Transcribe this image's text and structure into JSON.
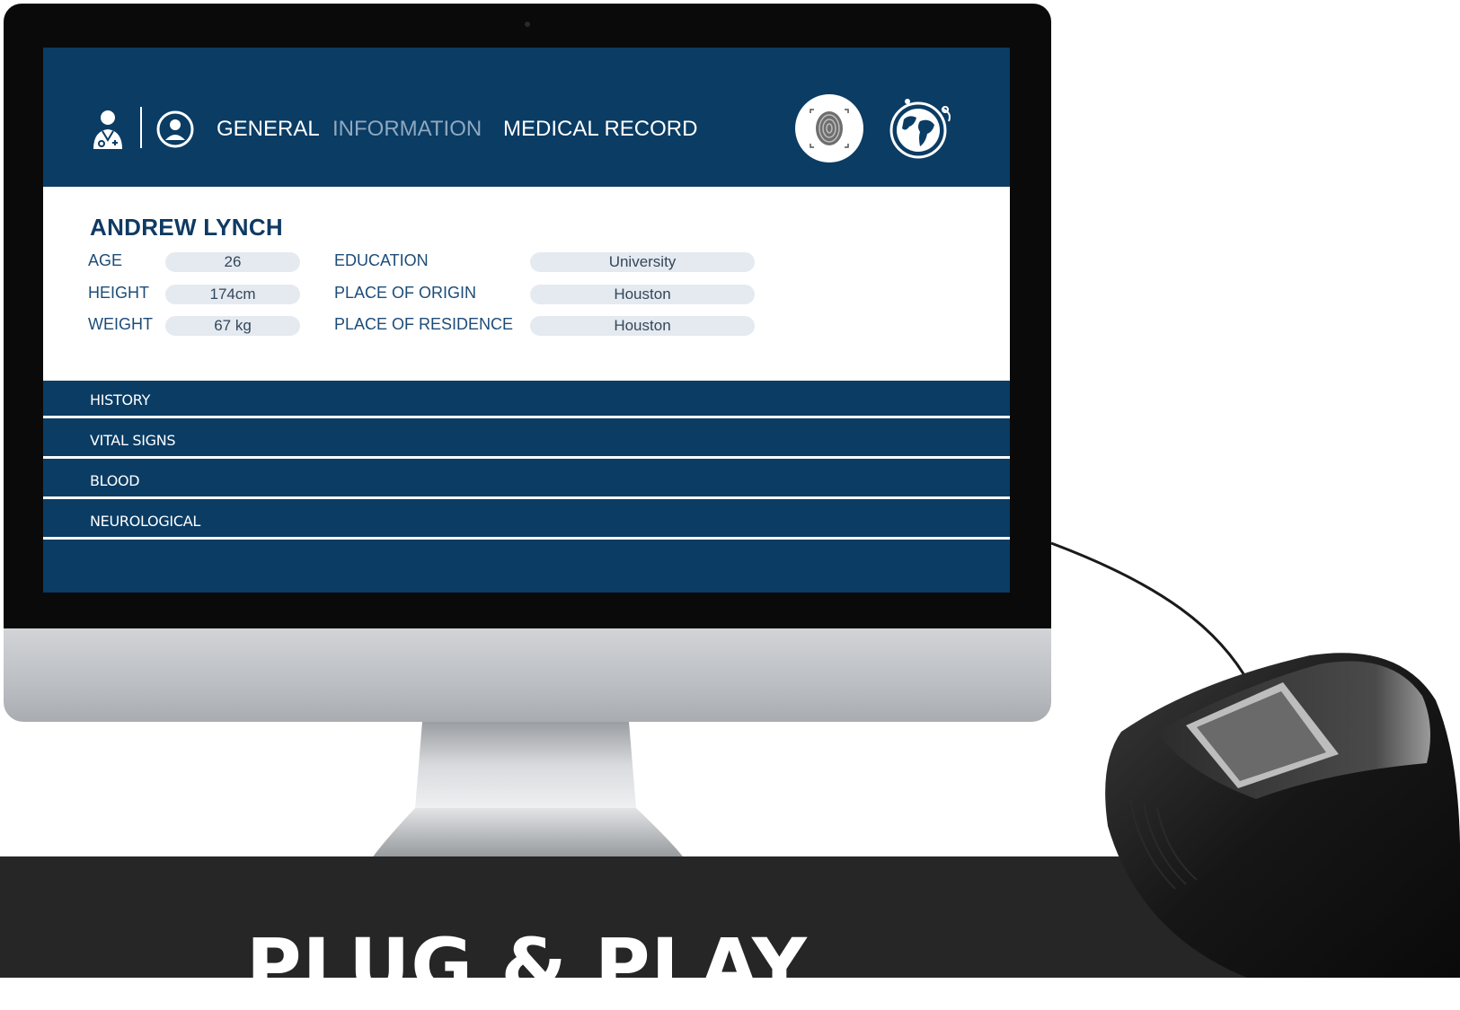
{
  "screen": {
    "nav": {
      "tabs": [
        {
          "label": "GENERAL"
        },
        {
          "label": "INFORMATION"
        },
        {
          "label": "MEDICAL RECORD"
        }
      ]
    },
    "patient": {
      "name": "ANDREW LYNCH",
      "fields_left": [
        {
          "label": "AGE",
          "value": "26"
        },
        {
          "label": "HEIGHT",
          "value": "174cm"
        },
        {
          "label": "WEIGHT",
          "value": "67 kg"
        }
      ],
      "fields_right": [
        {
          "label": "EDUCATION",
          "value": "University"
        },
        {
          "label": "PLACE OF ORIGIN",
          "value": "Houston"
        },
        {
          "label": "PLACE OF RESIDENCE",
          "value": "Houston"
        }
      ]
    },
    "sections": [
      {
        "label": "HISTORY"
      },
      {
        "label": "VITAL SIGNS"
      },
      {
        "label": "BLOOD"
      },
      {
        "label": "NEUROLOGICAL"
      }
    ]
  },
  "tagline": "PLUG & PLAY",
  "colors": {
    "screen_blue": "#0a3c64",
    "label_blue": "#1d4c78",
    "pill_bg": "#e5eaf0",
    "band_dark": "#262626"
  },
  "icons": [
    "doctor-icon",
    "user-circle-icon",
    "fingerprint-icon",
    "globe-stethoscope-icon"
  ]
}
